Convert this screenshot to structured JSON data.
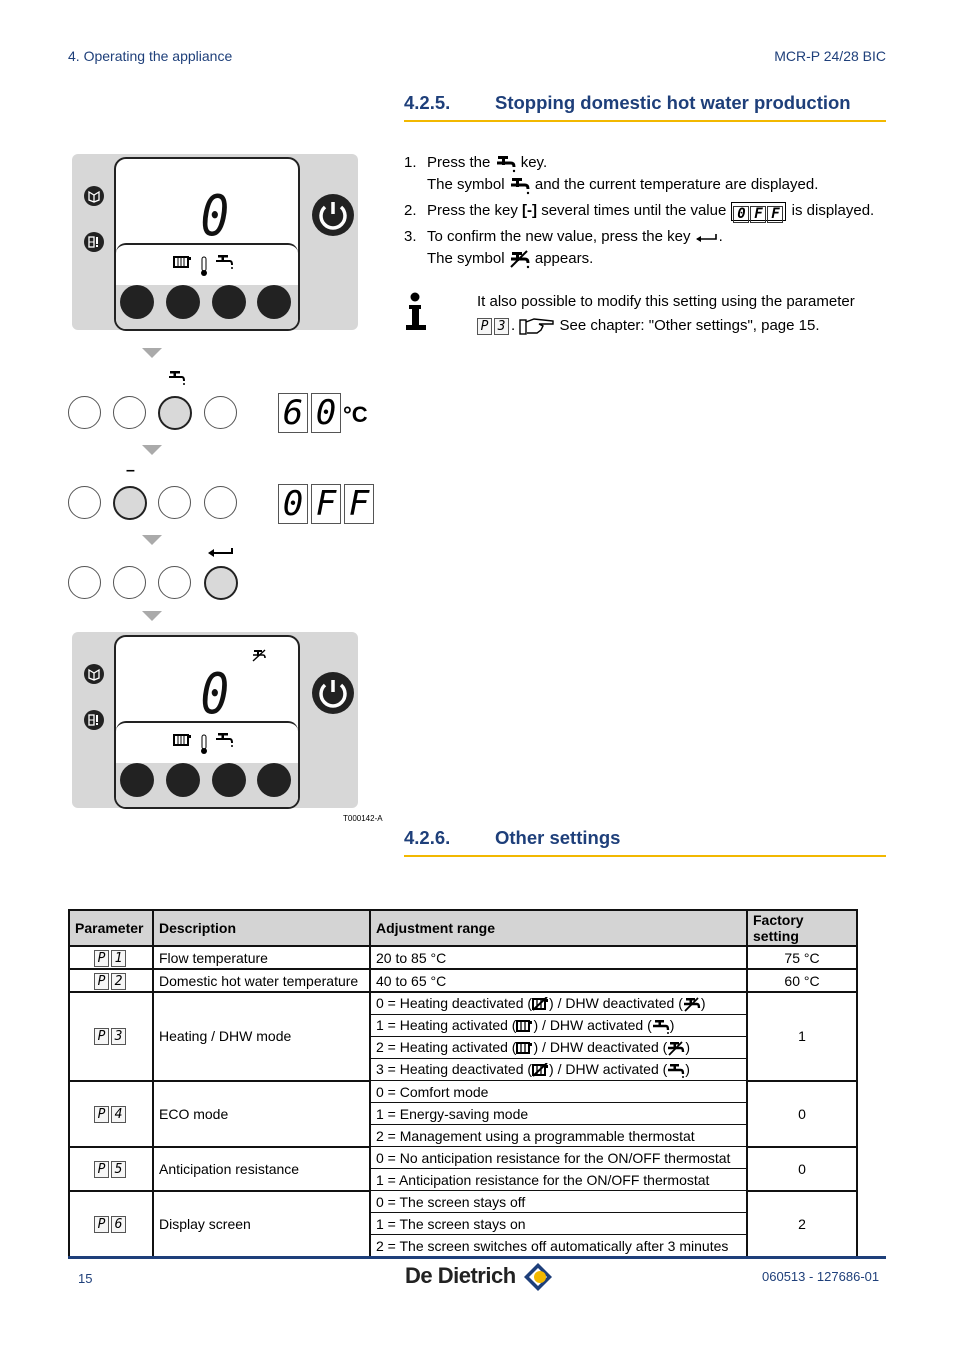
{
  "header": {
    "chapter": "4.  Operating the appliance",
    "model": "MCR-P 24/28 BIC"
  },
  "section1": {
    "number": "4.2.5.",
    "title": "Stopping domestic hot water production",
    "steps": [
      {
        "n": "1.",
        "parts": [
          "Press the",
          "key."
        ],
        "line2": [
          "The symbol",
          "and the current temperature are displayed."
        ]
      },
      {
        "n": "2.",
        "parts": [
          "Press the key",
          "[-]",
          "several times until the value",
          "is displayed."
        ],
        "value": [
          "0",
          "F",
          "F"
        ]
      },
      {
        "n": "3.",
        "parts": [
          "To confirm the new value, press the key",
          "."
        ],
        "line2": [
          "The symbol",
          "appears."
        ]
      }
    ],
    "note": {
      "text1": "It also possible to modify this setting using the parameter",
      "param": [
        "P",
        "3"
      ],
      "text2": "See chapter:  \"Other settings\", page 15."
    }
  },
  "figure": {
    "display_initial": "0",
    "display_final": "0",
    "temp_display": [
      "6",
      "0"
    ],
    "temp_unit": "°C",
    "off_display": [
      "0",
      "F",
      "F"
    ],
    "minus_label": "–",
    "figure_id": "T000142-A"
  },
  "section2": {
    "number": "4.2.6.",
    "title": "Other settings"
  },
  "table": {
    "headers": [
      "Parameter",
      "Description",
      "Adjustment range",
      "Factory setting"
    ],
    "rows": [
      {
        "param": [
          "P",
          "1"
        ],
        "description": "Flow temperature",
        "ranges": [
          "20 to 85 °C"
        ],
        "factory": "75 °C"
      },
      {
        "param": [
          "P",
          "2"
        ],
        "description": "Domestic hot water temperature",
        "ranges": [
          "40 to 65 °C"
        ],
        "factory": "60 °C"
      },
      {
        "param": [
          "P",
          "3"
        ],
        "description": "Heating / DHW mode",
        "ranges": [
          "0 = Heating deactivated (#rad-off#) / DHW deactivated (#tap-off#)",
          "1 = Heating activated (#rad-on#) / DHW activated (#tap-on#)",
          "2 = Heating activated (#rad-on#) / DHW deactivated (#tap-off#)",
          "3 = Heating deactivated (#rad-off#) / DHW activated (#tap-on#)"
        ],
        "factory": "1"
      },
      {
        "param": [
          "P",
          "4"
        ],
        "description": "ECO mode",
        "ranges": [
          "0 = Comfort mode",
          "1 = Energy-saving mode",
          "2 = Management using a programmable thermostat"
        ],
        "factory": "0"
      },
      {
        "param": [
          "P",
          "5"
        ],
        "description": "Anticipation resistance",
        "ranges": [
          "0 = No anticipation resistance for the ON/OFF thermostat",
          "1 = Anticipation resistance for the ON/OFF thermostat"
        ],
        "factory": "0"
      },
      {
        "param": [
          "P",
          "6"
        ],
        "description": "Display screen",
        "ranges": [
          "0 = The screen stays off",
          "1 = The screen stays on",
          "2 = The screen switches off automatically after 3 minutes"
        ],
        "factory": "2"
      }
    ]
  },
  "footer": {
    "page": "15",
    "brand": "De Dietrich",
    "doc_ref": "060513 - 127686-01"
  },
  "colors": {
    "heading": "#1e3f7a",
    "accent_rule": "#f2b800",
    "panel_gray": "#d7d7d7"
  }
}
